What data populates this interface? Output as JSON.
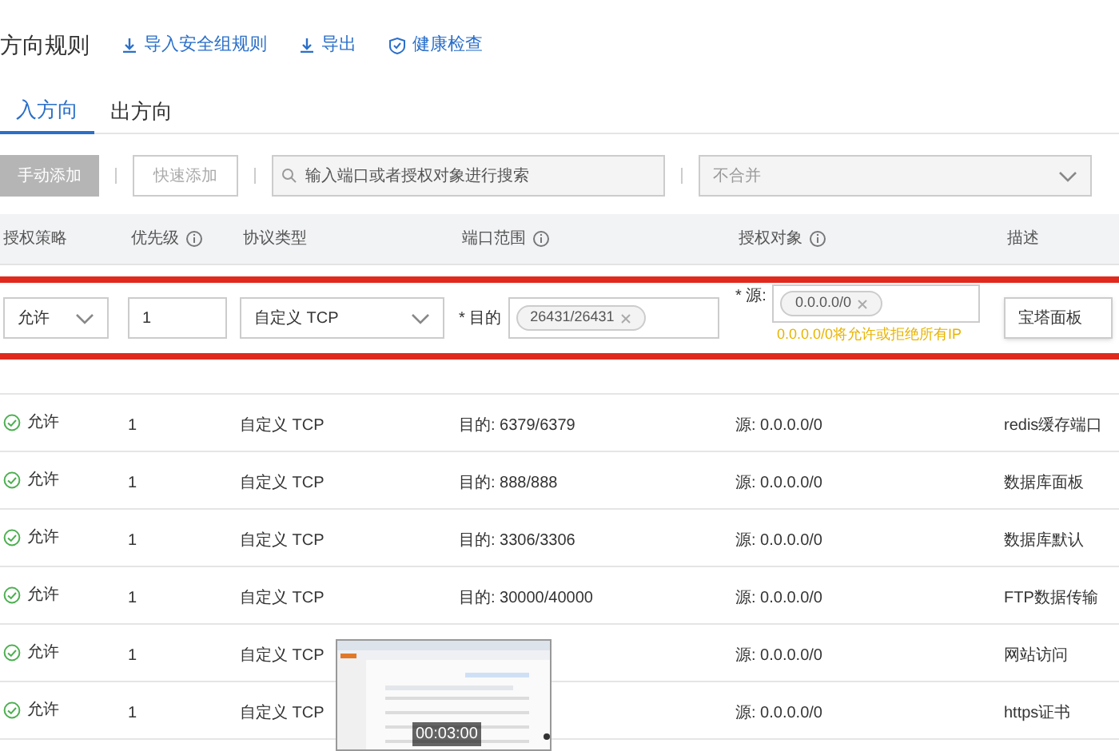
{
  "header": {
    "title": "方向规则",
    "actions": [
      {
        "kind": "import",
        "label": "导入安全组规则"
      },
      {
        "kind": "export",
        "label": "导出"
      },
      {
        "kind": "check",
        "label": "健康检查"
      }
    ]
  },
  "tabs": [
    {
      "label": "入方向",
      "selected": true
    },
    {
      "label": "出方向",
      "selected": false
    }
  ],
  "toolbar": {
    "manual_add": {
      "label": "手动添加",
      "disabled": true
    },
    "quick_add": {
      "label": "快速添加"
    },
    "search": {
      "placeholder": "输入端口或者授权对象进行搜索"
    },
    "merge_select": {
      "value": "不合并"
    }
  },
  "table": {
    "columns": [
      {
        "label": "授权策略",
        "info": false
      },
      {
        "label": "优先级",
        "info": true
      },
      {
        "label": "协议类型",
        "info": false
      },
      {
        "label": "端口范围",
        "info": true
      },
      {
        "label": "授权对象",
        "info": true
      },
      {
        "label": "描述",
        "info": false
      }
    ],
    "edit_row": {
      "policy": "允许",
      "priority": "1",
      "protocol": "自定义 TCP",
      "port_label": "* 目的",
      "port_tag": "26431/26431",
      "source_label": "* 源:",
      "source_tag": "0.0.0.0/0",
      "warning": "0.0.0.0/0将允许或拒绝所有IP",
      "description": "宝塔面板"
    },
    "rows": [
      {
        "policy": "允许",
        "priority": "1",
        "protocol": "自定义 TCP",
        "port": "目的: 6379/6379",
        "source": "源: 0.0.0.0/0",
        "description": "redis缓存端口"
      },
      {
        "policy": "允许",
        "priority": "1",
        "protocol": "自定义 TCP",
        "port": "目的: 888/888",
        "source": "源: 0.0.0.0/0",
        "description": "数据库面板"
      },
      {
        "policy": "允许",
        "priority": "1",
        "protocol": "自定义 TCP",
        "port": "目的: 3306/3306",
        "source": "源: 0.0.0.0/0",
        "description": "数据库默认"
      },
      {
        "policy": "允许",
        "priority": "1",
        "protocol": "自定义 TCP",
        "port": "目的: 30000/40000",
        "source": "源: 0.0.0.0/0",
        "description": "FTP数据传输"
      },
      {
        "policy": "允许",
        "priority": "1",
        "protocol": "自定义 TCP",
        "source": "源: 0.0.0.0/0",
        "description": "网站访问"
      },
      {
        "policy": "允许",
        "priority": "1",
        "protocol": "自定义 TCP",
        "source": "源: 0.0.0.0/0",
        "description": "https证书"
      }
    ]
  },
  "preview": {
    "time": "00:03:00"
  }
}
